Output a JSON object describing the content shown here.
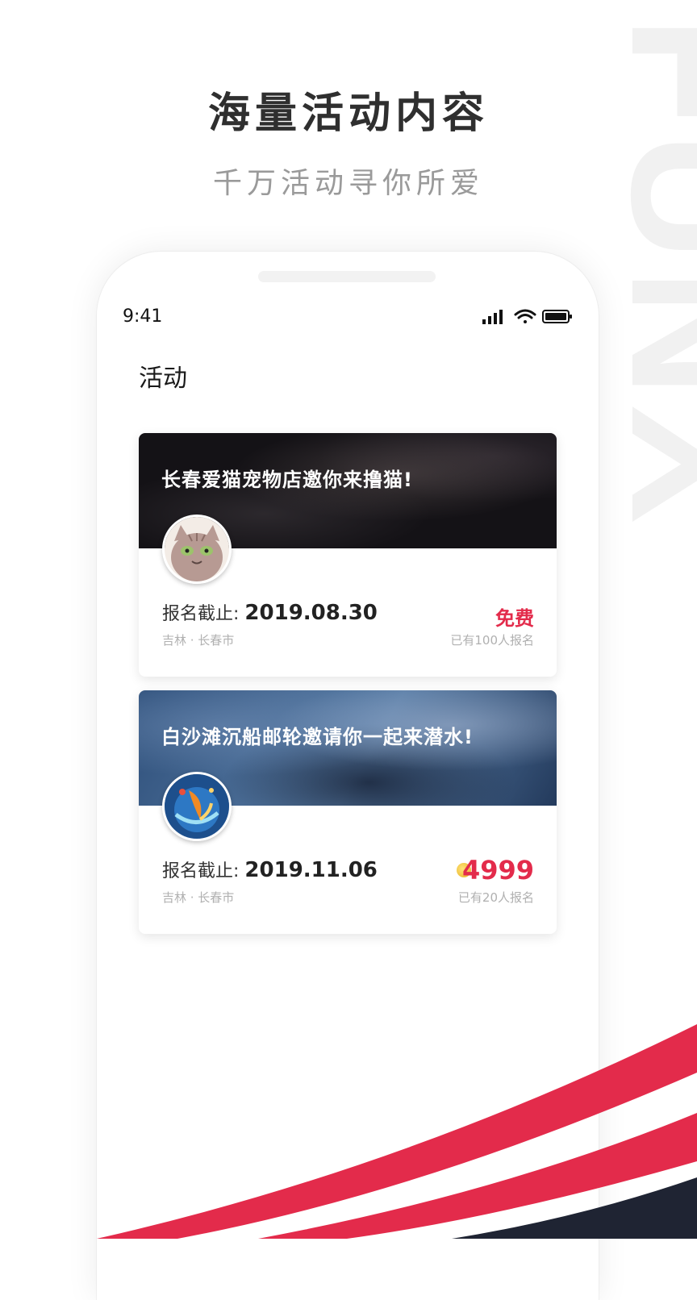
{
  "hero": {
    "title": "海量活动内容",
    "subtitle": "千万活动寻你所爱",
    "watermark": "FUNX"
  },
  "status_bar": {
    "time": "9:41"
  },
  "page": {
    "title": "活动"
  },
  "events": [
    {
      "title": "长春爱猫宠物店邀你来撸猫!",
      "deadline_label": "报名截止:",
      "deadline_date": "2019.08.30",
      "location": "吉林 · 长春市",
      "price": "免费",
      "signups": "已有100人报名"
    },
    {
      "title": "白沙滩沉船邮轮邀请你一起来潜水!",
      "deadline_label": "报名截止:",
      "deadline_date": "2019.11.06",
      "location": "吉林 · 长春市",
      "price": "4999",
      "signups": "已有20人报名"
    }
  ],
  "colors": {
    "accent": "#e32b4b",
    "dark_stripe": "#1f2433",
    "muted_text": "#b0b0b0"
  },
  "icons": [
    "signal-icon",
    "wifi-icon",
    "battery-icon",
    "coin-icon"
  ]
}
